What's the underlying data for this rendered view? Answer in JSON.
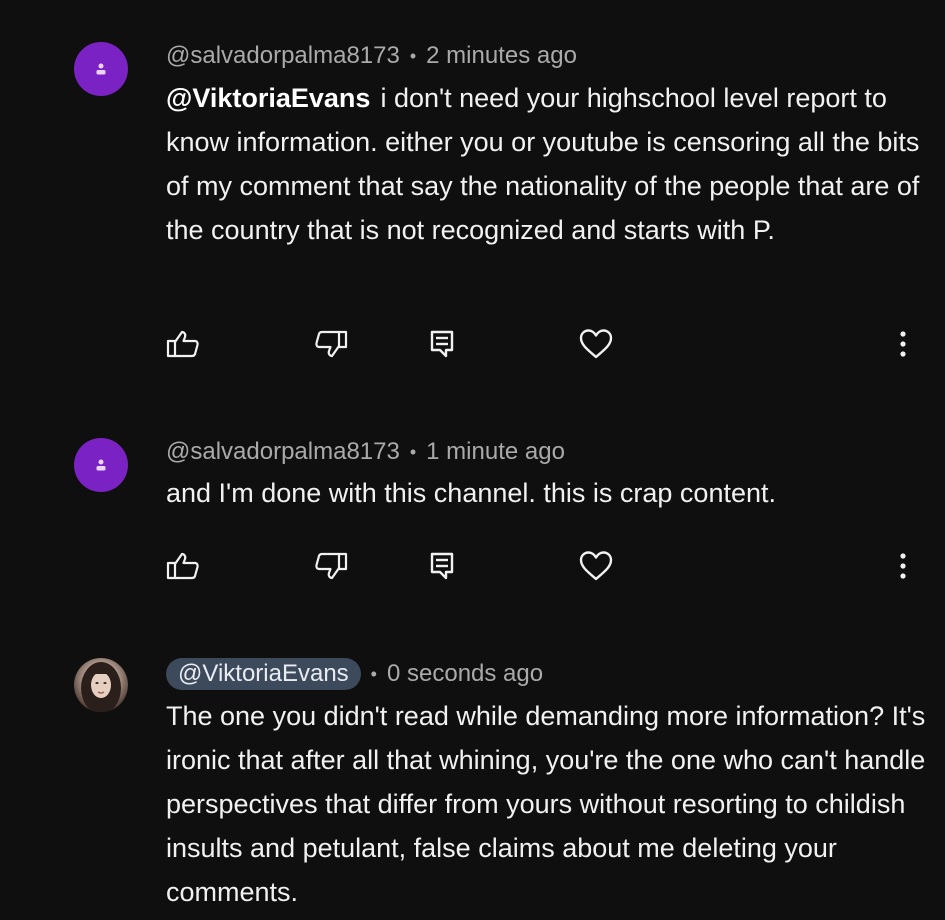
{
  "comments": [
    {
      "author": "@salvadorpalma8173",
      "time": "2 minutes ago",
      "mention": "@ViktoriaEvans",
      "text": "i don't need your highschool level report to know information. either you or youtube is censoring all the bits of my comment that say the nationality of the people that are of the country that is not recognized and starts with P.",
      "avatar_color": "#7b22c4"
    },
    {
      "author": "@salvadorpalma8173",
      "time": "1 minute ago",
      "text": "and I'm done with this channel. this is crap content.",
      "avatar_color": "#7b22c4"
    },
    {
      "author": "@ViktoriaEvans",
      "time": "0 seconds ago",
      "text": "The one you didn't read while demanding more information? It's ironic that after all that whining, you're the one who can't handle perspectives that differ from yours without resorting to childish insults and petulant, false claims about me deleting your comments.",
      "author_chip_color": "#3c4a5c"
    }
  ],
  "meta_separator": "•",
  "icons": {
    "like": "thumb-up-icon",
    "dislike": "thumb-down-icon",
    "reply": "reply-icon",
    "heart": "heart-icon",
    "more": "more-vertical-icon"
  }
}
